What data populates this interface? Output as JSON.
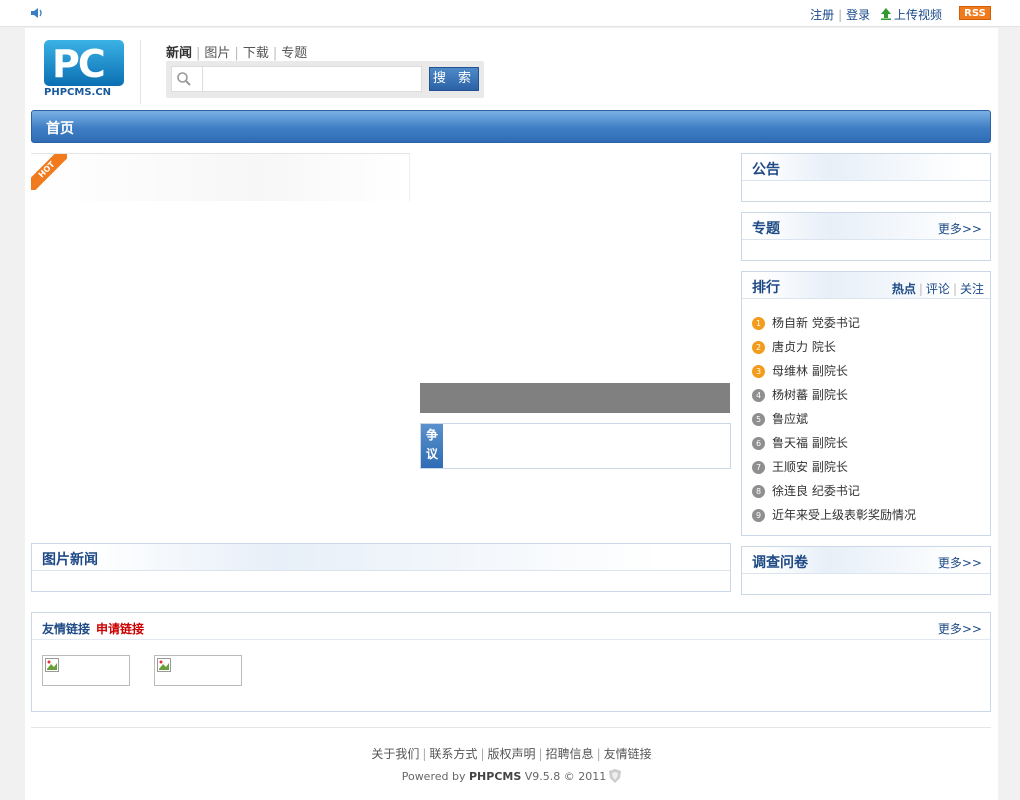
{
  "topbar": {
    "links": [
      "注册",
      "登录",
      "上传视频"
    ],
    "rss_label": "RSS"
  },
  "header": {
    "logo_text": "PHPCMS.CN",
    "logo_mark": "PC",
    "search_tabs": [
      "新闻",
      "图片",
      "下载",
      "专题"
    ],
    "search_placeholder": "",
    "search_button": "搜 索"
  },
  "nav": {
    "home": "首页"
  },
  "hot_badge": "HOT",
  "debate": {
    "label": "争议"
  },
  "picnews": {
    "title": "图片新闻"
  },
  "notice": {
    "title": "公告"
  },
  "topics": {
    "title": "专题",
    "more": "更多>>"
  },
  "ranking": {
    "title": "排行",
    "tabs": [
      "热点",
      "评论",
      "关注"
    ],
    "items": [
      {
        "num": "1",
        "text": "杨自新 党委书记"
      },
      {
        "num": "2",
        "text": "唐贞力 院长"
      },
      {
        "num": "3",
        "text": "母维林 副院长"
      },
      {
        "num": "4",
        "text": "杨树蕃 副院长"
      },
      {
        "num": "5",
        "text": "鲁应斌"
      },
      {
        "num": "6",
        "text": "鲁天福 副院长"
      },
      {
        "num": "7",
        "text": "王顺安 副院长"
      },
      {
        "num": "8",
        "text": "徐连良 纪委书记"
      },
      {
        "num": "9",
        "text": "近年来受上级表彰奖励情况"
      }
    ],
    "colors": {
      "top3": "#f39b1b",
      "rest": "#8f8f8f"
    }
  },
  "survey": {
    "title": "调查问卷",
    "more": "更多>>"
  },
  "friend_links": {
    "title": "友情链接",
    "apply": "申请链接",
    "more": "更多>>"
  },
  "footer": {
    "links": [
      "关于我们",
      "联系方式",
      "版权声明",
      "招聘信息",
      "友情链接"
    ],
    "powered_prefix": "Powered by ",
    "powered_brand": "PHPCMS",
    "powered_suffix": " V9.5.8 © 2011"
  }
}
